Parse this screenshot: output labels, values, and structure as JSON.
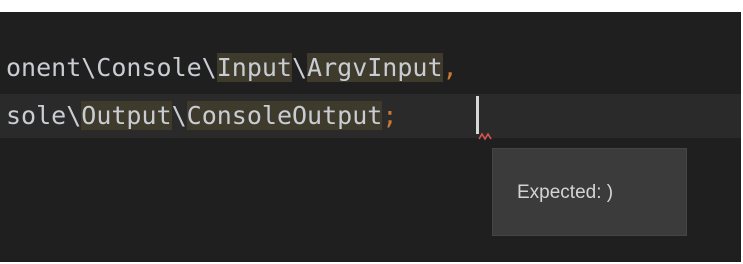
{
  "editor": {
    "line1": {
      "seg_a": "onent\\Console\\",
      "seg_b": "Input",
      "seg_c": "\\",
      "seg_d": "ArgvInput",
      "seg_e": ","
    },
    "line2": {
      "seg_a": "sole\\",
      "seg_b": "Output",
      "seg_c": "\\",
      "seg_d": "ConsoleOutput",
      "seg_e": ";"
    }
  },
  "tooltip": {
    "message": "Expected: )"
  },
  "colors": {
    "background": "#1f1f1f",
    "current_line": "#2a2a2a",
    "highlight": "#3e3b2c",
    "punctuation": "#cc7832",
    "error": "#d9534f"
  }
}
